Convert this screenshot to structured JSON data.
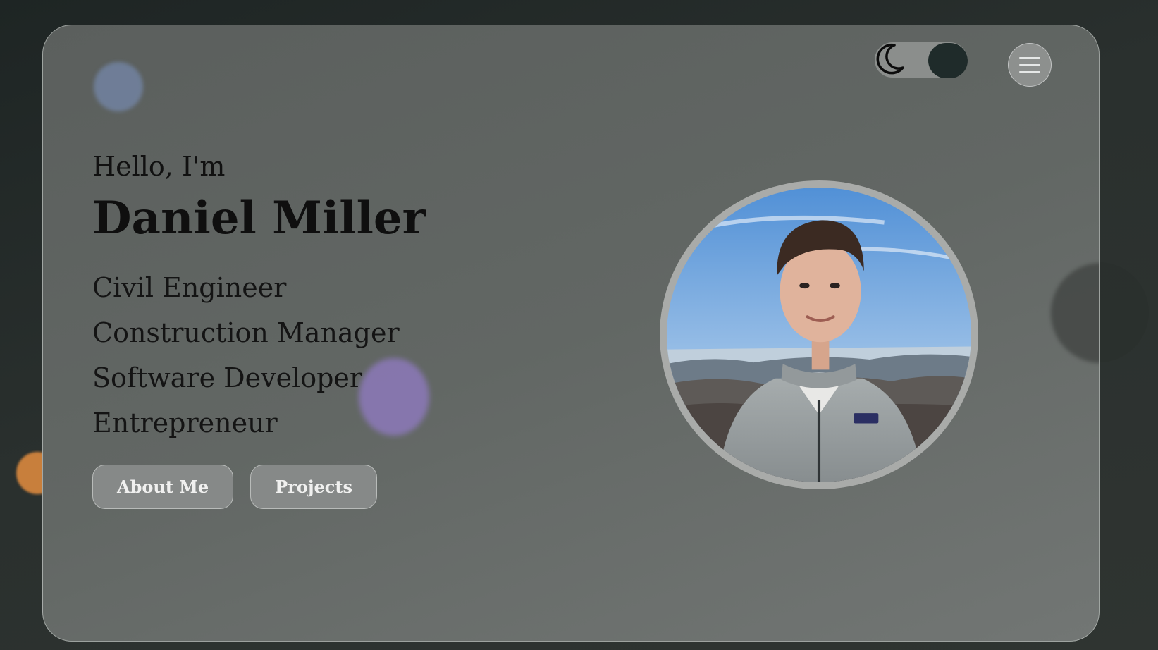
{
  "header": {
    "theme_toggle": {
      "icon": "moon-icon",
      "state": "dark"
    },
    "menu_button": {
      "icon": "hamburger-menu-icon"
    }
  },
  "hero": {
    "greeting": "Hello, I'm",
    "name": "Daniel Miller",
    "roles": [
      "Civil Engineer",
      "Construction Manager",
      "Software Developer",
      "Entrepreneur"
    ],
    "buttons": {
      "about": "About Me",
      "projects": "Projects"
    }
  },
  "portrait": {
    "description_icon": "profile-photo",
    "brand_patch": "patagonia"
  },
  "colors": {
    "background": "#252b29",
    "card": "#626764",
    "toggle_knob": "#1f2b2a",
    "blob_blue": "#7283a1",
    "blob_purple": "#8a78b5",
    "blob_orange": "#c87f3c"
  }
}
